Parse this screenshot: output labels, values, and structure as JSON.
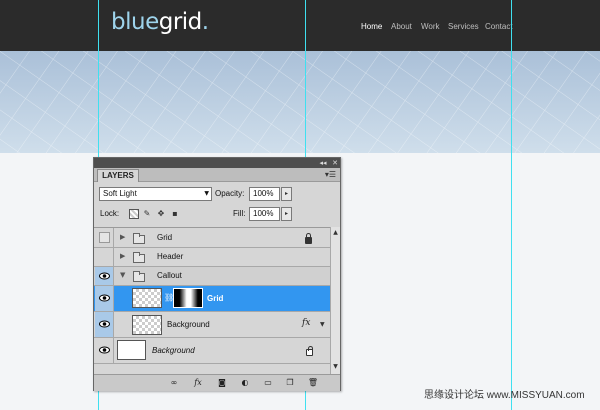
{
  "site": {
    "logo_part1": "blue",
    "logo_part2": "grid",
    "logo_dot": ".",
    "nav": [
      "Home",
      "About",
      "Work",
      "Services",
      "Contact"
    ]
  },
  "panel": {
    "tab_label": "LAYERS",
    "titlebar": {
      "collapse_icon": "collapse-icon",
      "close_icon": "close-icon"
    },
    "blend_mode": "Soft Light",
    "opacity_label": "Opacity:",
    "opacity_value": "100%",
    "lock_label": "Lock:",
    "fill_label": "Fill:",
    "fill_value": "100%",
    "layers": [
      {
        "name": "Grid",
        "type": "group",
        "visible": false,
        "expanded": false,
        "locked": true
      },
      {
        "name": "Header",
        "type": "group",
        "visible": true,
        "expanded": false
      },
      {
        "name": "Callout",
        "type": "group",
        "visible": true,
        "expanded": true
      },
      {
        "name": "Grid",
        "type": "layer",
        "visible": true,
        "selected": true,
        "has_mask": true
      },
      {
        "name": "Background",
        "type": "layer",
        "visible": true,
        "has_fx": true
      },
      {
        "name": "Background",
        "type": "background",
        "visible": true,
        "locked": true
      }
    ],
    "footer_icons": [
      "link-layers-icon",
      "fx-icon",
      "mask-icon",
      "adjustment-icon",
      "new-group-icon",
      "new-layer-icon",
      "trash-icon"
    ]
  },
  "watermark": "思缘设计论坛 www.MISSYUAN.com",
  "colors": {
    "header_bg": "#2b2b2b",
    "logo_accent": "#9ed4ec",
    "selection": "#3296f0",
    "guide": "#3fe0f0"
  }
}
